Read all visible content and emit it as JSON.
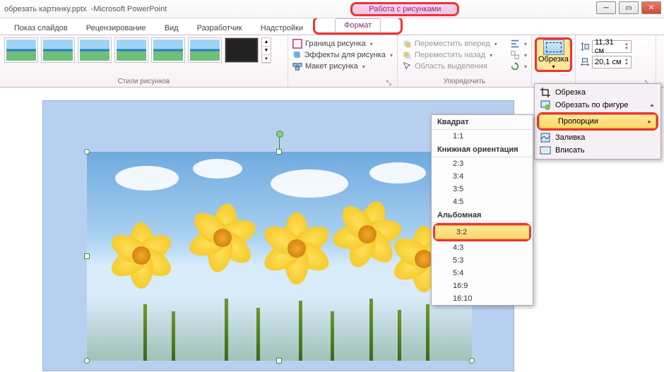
{
  "title": {
    "doc": "обрезать картинку.pptx",
    "sep": " - ",
    "app": "Microsoft PowerPoint"
  },
  "contextual": {
    "group": "Работа с рисунками",
    "tab": "Формат"
  },
  "tabs": [
    "Показ слайдов",
    "Рецензирование",
    "Вид",
    "Разработчик",
    "Надстройки"
  ],
  "ribbon": {
    "styles_label": "Стили рисунков",
    "format": {
      "border": "Граница рисунка",
      "effects": "Эффекты для рисунка",
      "layout": "Макет рисунка"
    },
    "arrange": {
      "forward": "Переместить вперед",
      "backward": "Переместить назад",
      "selection": "Область выделения",
      "label": "Упорядочить"
    },
    "crop_btn": "Обрезка",
    "size": {
      "height": "11,31 см",
      "width": "20,1 см"
    }
  },
  "crop_menu": {
    "crop": "Обрезка",
    "shape": "Обрезать по фигуре",
    "aspect": "Пропорции",
    "fill": "Заливка",
    "fit": "Вписать"
  },
  "aspect": {
    "square": "Квадрат",
    "square_items": [
      "1:1"
    ],
    "portrait": "Книжная ориентация",
    "portrait_items": [
      "2:3",
      "3:4",
      "3:5",
      "4:5"
    ],
    "landscape": "Альбомная",
    "landscape_items": [
      "3:2",
      "4:3",
      "5:3",
      "5:4",
      "16:9",
      "16:10"
    ]
  }
}
